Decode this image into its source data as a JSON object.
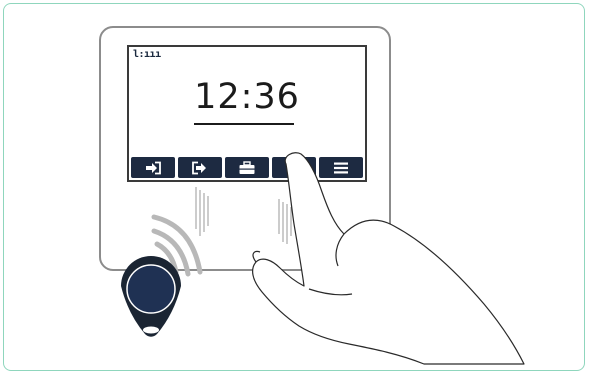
{
  "screen": {
    "status_indicator": "l:ııı",
    "time": "12:36"
  },
  "function_buttons": [
    {
      "icon": "login-arrow-icon"
    },
    {
      "icon": "logout-arrow-icon"
    },
    {
      "icon": "briefcase-icon"
    },
    {
      "icon": "info-icon"
    },
    {
      "icon": "menu-icon"
    }
  ],
  "colors": {
    "frame_border": "#8fd6bd",
    "button_bg": "#1d2a41",
    "device_border": "#8c8c8c",
    "tag": "#1d2a41"
  }
}
